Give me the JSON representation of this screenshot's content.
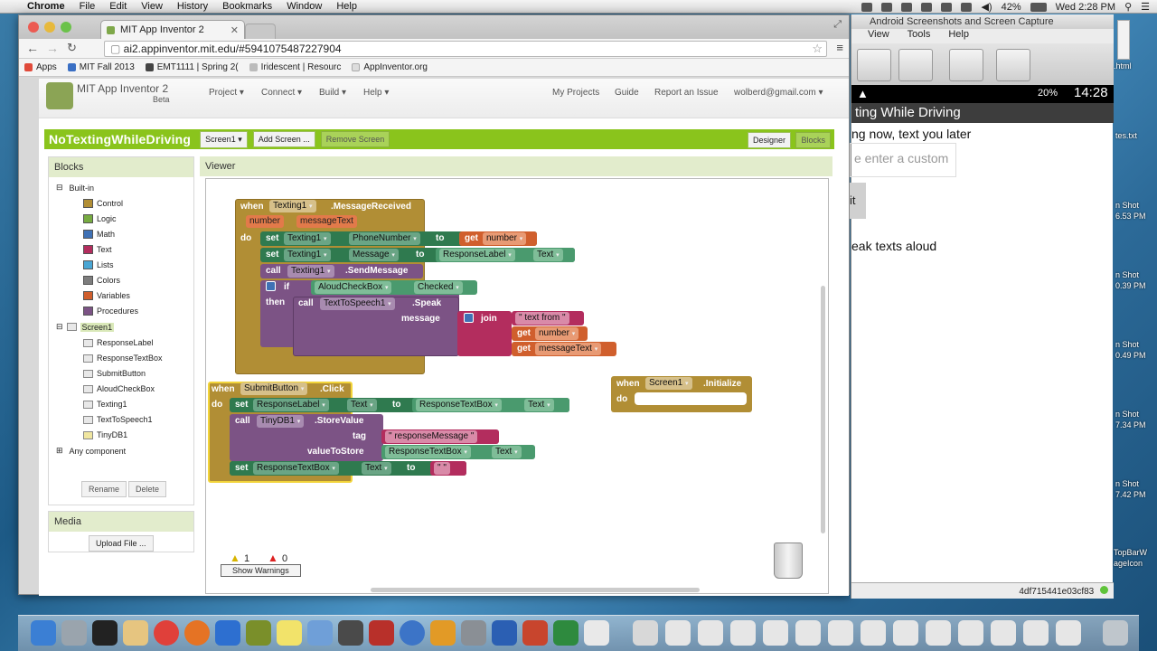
{
  "menubar": {
    "app": "Chrome",
    "items": [
      "File",
      "Edit",
      "View",
      "History",
      "Bookmarks",
      "Window",
      "Help"
    ],
    "battery": "42%",
    "clock": "Wed 2:28 PM"
  },
  "chrome": {
    "tab_title": "MIT App Inventor 2",
    "url": "ai2.appinventor.mit.edu/#5941075487227904",
    "bookmarks": [
      "Apps",
      "MIT Fall 2013",
      "EMT1111 | Spring 2(",
      "Iridescent | Resourc",
      "AppInventor.org"
    ]
  },
  "appinventor": {
    "logo_text": "MIT App Inventor 2",
    "beta": "Beta",
    "nav": [
      "Project ▾",
      "Connect ▾",
      "Build ▾",
      "Help ▾"
    ],
    "right_nav": [
      "My Projects",
      "Guide",
      "Report an Issue",
      "wolberd@gmail.com ▾"
    ],
    "project_title": "NoTextingWhileDriving",
    "screen_btn": "Screen1 ▾",
    "add_screen": "Add Screen ...",
    "remove_screen": "Remove Screen",
    "designer": "Designer",
    "blocks_btn": "Blocks"
  },
  "blocks_panel": {
    "title": "Blocks",
    "builtin": "Built-in",
    "categories": [
      {
        "label": "Control",
        "color": "#b18e35"
      },
      {
        "label": "Logic",
        "color": "#77ab41"
      },
      {
        "label": "Math",
        "color": "#3f71b5"
      },
      {
        "label": "Text",
        "color": "#b32d5e"
      },
      {
        "label": "Lists",
        "color": "#49a6d4"
      },
      {
        "label": "Colors",
        "color": "#7d7d7d"
      },
      {
        "label": "Variables",
        "color": "#d05f2d"
      },
      {
        "label": "Procedures",
        "color": "#7c5385"
      }
    ],
    "screen": "Screen1",
    "components": [
      "ResponseLabel",
      "ResponseTextBox",
      "SubmitButton",
      "AloudCheckBox",
      "Texting1",
      "TextToSpeech1",
      "TinyDB1"
    ],
    "any_component": "Any component",
    "rename": "Rename",
    "delete": "Delete"
  },
  "media": {
    "title": "Media",
    "upload": "Upload File ..."
  },
  "viewer": {
    "title": "Viewer",
    "warnings_count": "1",
    "errors_count": "0",
    "show_warnings": "Show Warnings"
  },
  "code": {
    "b1": {
      "when": "when",
      "comp": "Texting1",
      "event": ".MessageReceived",
      "param1": "number",
      "param2": "messageText",
      "do": "do",
      "set": "set",
      "to": "to",
      "get": "get",
      "call": "call",
      "prop_phone": "PhoneNumber",
      "prop_message": "Message",
      "resp_label": "ResponseLabel",
      "text_prop": "Text",
      "send": ".SendMessage",
      "if": "if",
      "then": "then",
      "aloud": "AloudCheckBox",
      "checked": "Checked",
      "tts": "TextToSpeech1",
      "speak": ".Speak",
      "message": "message",
      "join": "join",
      "text_from": "\" text from \"",
      "message_text": "messageText"
    },
    "b2": {
      "when": "when",
      "comp": "SubmitButton",
      "event": ".Click",
      "do": "do",
      "set": "set",
      "to": "to",
      "call": "call",
      "resp_label": "ResponseLabel",
      "text_prop": "Text",
      "resp_box": "ResponseTextBox",
      "tinydb": "TinyDB1",
      "store": ".StoreValue",
      "tag": "tag",
      "tag_value": "\" responseMessage \"",
      "value_to_store": "valueToStore",
      "empty": "\" \""
    },
    "b3": {
      "when": "when",
      "comp": "Screen1",
      "event": ".Initialize",
      "do": "do"
    }
  },
  "android": {
    "window_title": "Android Screenshots and Screen Capture",
    "menu": [
      "View",
      "Tools",
      "Help"
    ],
    "status_pct": "20%",
    "status_time": "14:28",
    "app_title": "ting While Driving",
    "line1": "ng now, text you later",
    "input_placeholder": "e enter a custom",
    "button_fragment": "it",
    "check_label": "eak texts aloud",
    "device_id": "4df715441e03cf83"
  },
  "desktop_labels": [
    ".html",
    "tes.txt",
    "n Shot",
    "6.53 PM",
    "n Shot",
    "0.39 PM",
    "n Shot",
    "0.49 PM",
    "n Shot",
    "7.34 PM",
    "n Shot",
    "7.42 PM",
    "TopBarW",
    "ageIcon"
  ]
}
